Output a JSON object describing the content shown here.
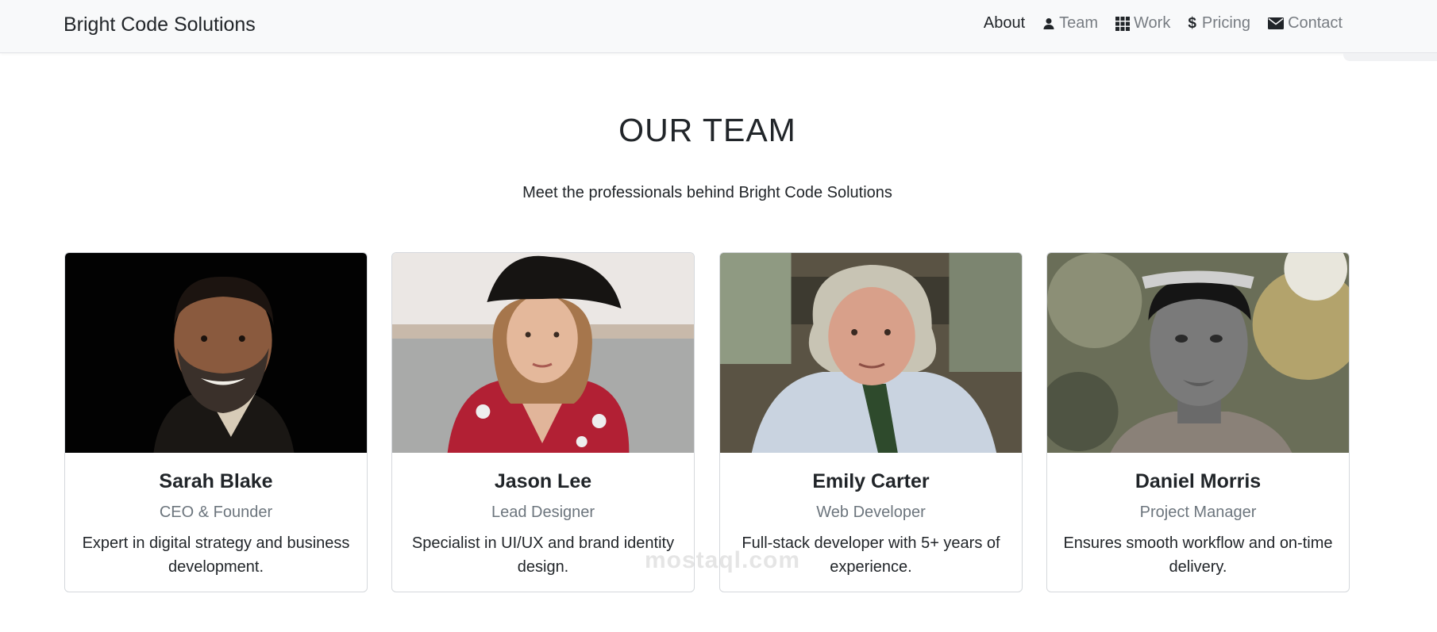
{
  "brand": "Bright Code Solutions",
  "nav": [
    {
      "label": "About",
      "icon": "none"
    },
    {
      "label": "Team",
      "icon": "person-icon"
    },
    {
      "label": "Work",
      "icon": "grid-icon"
    },
    {
      "label": "Pricing",
      "icon": "dollar-icon"
    },
    {
      "label": "Contact",
      "icon": "envelope-icon"
    }
  ],
  "section": {
    "title": "OUR TEAM",
    "subtitle": "Meet the professionals behind Bright Code Solutions"
  },
  "members": [
    {
      "name": "Sarah Blake",
      "role": "CEO & Founder",
      "description": "Expert in digital strategy and business development."
    },
    {
      "name": "Jason Lee",
      "role": "Lead Designer",
      "description": "Specialist in UI/UX and brand identity design."
    },
    {
      "name": "Emily Carter",
      "role": "Web Developer",
      "description": "Full-stack developer with 5+ years of experience."
    },
    {
      "name": "Daniel Morris",
      "role": "Project Manager",
      "description": "Ensures smooth workflow and on-time delivery."
    }
  ],
  "watermark": "mostaql.com",
  "colors": {
    "navbar_bg": "#f8f9fa",
    "text": "#212529",
    "muted": "#6c757d",
    "nav_muted": "#777c82"
  }
}
